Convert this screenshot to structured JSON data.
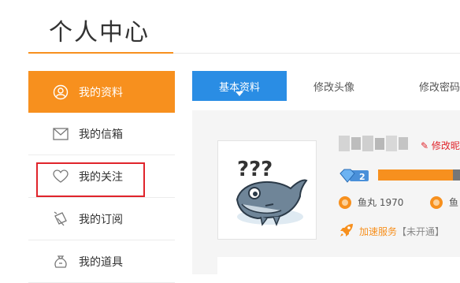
{
  "header": {
    "title": "个人中心"
  },
  "sidebar": {
    "items": [
      {
        "label": "我的资料",
        "icon": "user-icon",
        "active": true
      },
      {
        "label": "我的信箱",
        "icon": "mail-icon"
      },
      {
        "label": "我的关注",
        "icon": "heart-icon"
      },
      {
        "label": "我的订阅",
        "icon": "subscribe-icon"
      },
      {
        "label": "我的道具",
        "icon": "bag-icon"
      }
    ]
  },
  "tabs": [
    {
      "label": "基本资料",
      "active": true
    },
    {
      "label": "修改头像"
    },
    {
      "label": "修改密码"
    }
  ],
  "profile": {
    "edit_label": "修改昵",
    "level": "2",
    "fish_ball": "鱼丸 1970",
    "fish_cut": "鱼",
    "speed_link": "加速服务",
    "speed_status": "【未开通】"
  },
  "colors": {
    "accent": "#f7901e",
    "tab_active": "#2a8de4",
    "highlight": "#e0242b"
  }
}
